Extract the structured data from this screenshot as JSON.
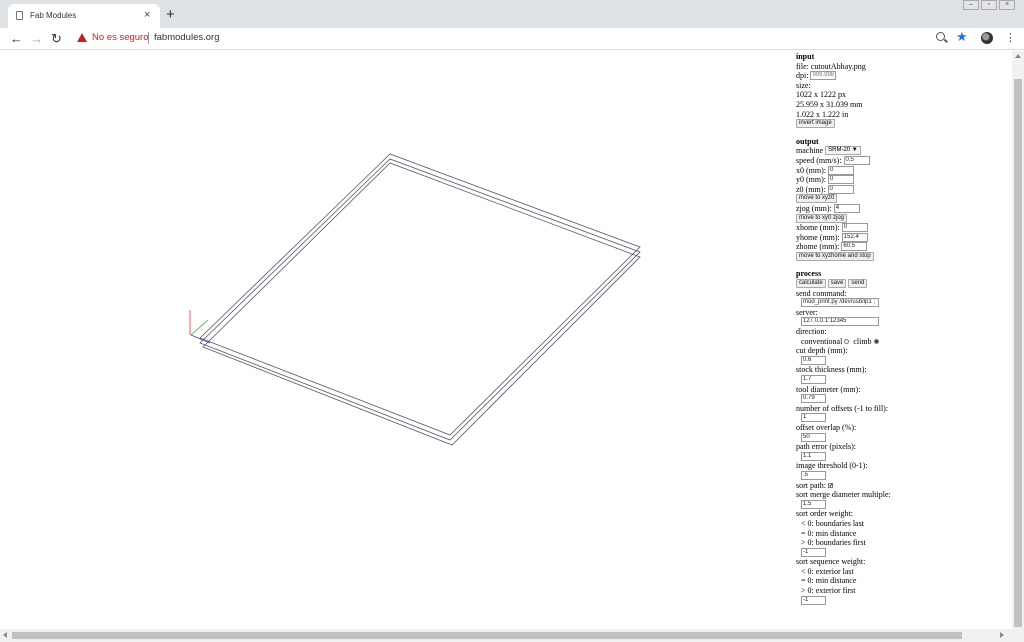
{
  "browser": {
    "tab_title": "Fab Modules",
    "tab_close": "×",
    "new_tab": "+",
    "security_text": "No es seguro",
    "url": "fabmodules.org",
    "icons": [
      "document-icon",
      "back-arrow-icon",
      "forward-arrow-icon",
      "reload-icon",
      "warning-icon",
      "zoom-icon",
      "star-icon",
      "avatar",
      "menu-icon"
    ]
  },
  "input": {
    "heading": "input",
    "file_line": "file: cutoutAbhay.png",
    "dpi_label": "dpi:",
    "dpi_value": "999.998",
    "size_label": "size:",
    "size_px": "1022 x 1222 px",
    "size_mm": "25.959 x 31.039 mm",
    "size_in": "1.022 x 1.222 in",
    "invert_button": "invert image"
  },
  "output": {
    "heading": "output",
    "machine_label": "machine",
    "machine_value": "SRM-20 ▼",
    "speed_label": "speed (mm/s):",
    "speed_value": "0.5",
    "x0_label": "x0 (mm):",
    "x0_value": "0",
    "y0_label": "y0 (mm):",
    "y0_value": "0",
    "z0_label": "z0 (mm):",
    "z0_value": "0",
    "move_xyz0_button": "move to xyz0",
    "zjog_label": "zjog (mm):",
    "zjog_value": "4",
    "move_xy0_zjog_button": "move to xy0 zjog",
    "xhome_label": "xhome (mm):",
    "xhome_value": "0",
    "yhome_label": "yhome (mm):",
    "yhome_value": "152.4",
    "zhome_label": "zhome (mm):",
    "zhome_value": "60.5",
    "move_home_button": "move to xyzhome and stop"
  },
  "process": {
    "heading": "process",
    "calculate_button": "calculate",
    "save_button": "save",
    "send_button": "send",
    "send_command_label": "send command:",
    "send_command_value": "mod_print.py /dev/usb/lp1 ;",
    "server_label": "server:",
    "server_value": "127.0.0.1:12345",
    "direction_label": "direction:",
    "conventional_label": "conventional",
    "climb_label": "climb",
    "cut_depth_label": "cut depth (mm):",
    "cut_depth_value": "0.6",
    "stock_thickness_label": "stock thickness (mm):",
    "stock_thickness_value": "1.7",
    "tool_diameter_label": "tool diameter (mm):",
    "tool_diameter_value": "0.79",
    "offsets_label": "number of offsets (-1 to fill):",
    "offsets_value": "1",
    "overlap_label": "offset overlap (%):",
    "overlap_value": "50",
    "path_error_label": "path error (pixels):",
    "path_error_value": "1.1",
    "threshold_label": "image threshold (0-1):",
    "threshold_value": ".5",
    "sort_path_label": "sort path:",
    "sort_path_check": "✔",
    "sort_merge_label": "sort merge diameter multiple:",
    "sort_merge_value": "1.5",
    "order_weight_label": "sort order weight:",
    "order_lt": "< 0: boundaries last",
    "order_eq": "= 0: min distance",
    "order_gt": "> 0: boundaries first",
    "order_weight_value": "-1",
    "sequence_weight_label": "sort sequence weight:",
    "seq_lt": "< 0: exterior last",
    "seq_eq": "= 0: min distance",
    "seq_gt": "> 0: exterior first",
    "sequence_weight_value": "-1"
  },
  "colors": {
    "toolpath": "#55556a",
    "axis_x": "#d04040",
    "axis_y": "#40a040",
    "axis_z": "#4040c0",
    "insecure": "#c5221f",
    "star": "#1a73e8"
  }
}
